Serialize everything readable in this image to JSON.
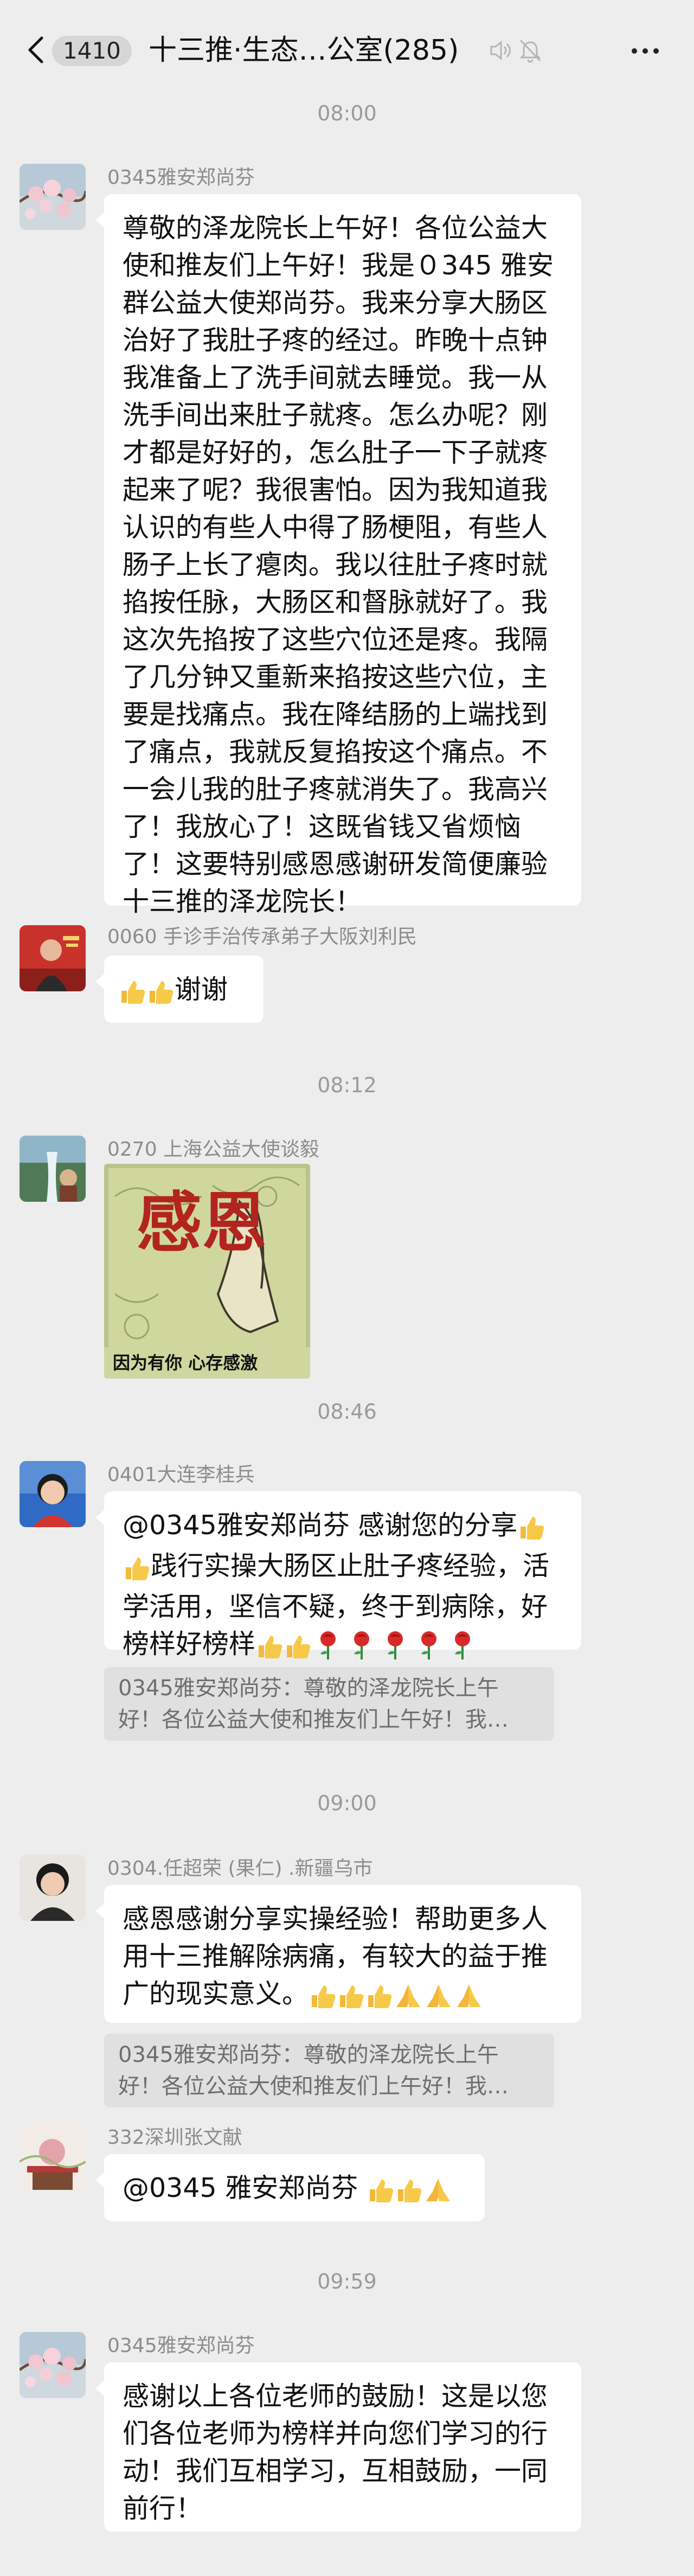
{
  "header": {
    "unread_count": "1410",
    "title": "十三推·生态…公室(285)",
    "mute_icon": "speaker-off-icon",
    "bell_icon": "bell-off-icon",
    "more_icon": "more-dots-icon"
  },
  "timestamps": [
    "08:00",
    "08:12",
    "08:46",
    "09:00",
    "09:59"
  ],
  "messages": [
    {
      "sender": "0345雅安郑尚芬",
      "text": "尊敬的泽龙院长上午好！各位公益大使和推友们上午好！我是０345 雅安群公益大使郑尚芬。我来分享大肠区治好了我肚子疼的经过。昨晚十点钟我准备上了洗手间就去睡觉。我一从洗手间出来肚子就疼。怎么办呢？刚才都是好好的，怎么肚子一下子就疼起来了呢？我很害怕。因为我知道我认识的有些人中得了肠梗阻，有些人肠子上长了瘪肉。我以往肚子疼时就掐按任脉，大肠区和督脉就好了。我这次先掐按了这些穴位还是疼。我隔了几分钟又重新来掐按这些穴位，主要是找痛点。我在降结肠的上端找到了痛点，我就反复掐按这个痛点。不一会儿我的肚子疼就消失了。我高兴了！我放心了！这既省钱又省烦恼了！这要特别感恩感谢研发简便廉验十三推的泽龙院长！"
    },
    {
      "sender": "0060 手诊手治传承弟子大阪刘利民",
      "text": "谢谢"
    },
    {
      "sender": "0270 上海公益大使谈毅",
      "image_title": "感恩",
      "image_caption": "因为有你 心存感激"
    },
    {
      "sender": "0401大连李桂兵",
      "text_part1": "@0345雅安郑尚芬  感谢您的分享",
      "text_part2": "践行实操大肠区止肚子疼经验，活学活用，坚信不疑，终于到病除，好榜样好榜样",
      "quote_line1": "0345雅安郑尚芬：尊敬的泽龙院长上午",
      "quote_line2": "好！各位公益大使和推友们上午好！我…"
    },
    {
      "sender": "0304.任超荣 (果仁) .新疆乌市",
      "text": "感恩感谢分享实操经验！帮助更多人用十三推解除病痛，有较大的益于推广的现实意义。",
      "quote_line1": "0345雅安郑尚芬：尊敬的泽龙院长上午",
      "quote_line2": "好！各位公益大使和推友们上午好！我…"
    },
    {
      "sender": "332深圳张文献",
      "text": "@0345 雅安郑尚芬 "
    },
    {
      "sender": "0345雅安郑尚芬",
      "text": "感谢以上各位老师的鼓励！这是以您们各位老师为榜样并向您们学习的行动！我们互相学习，互相鼓励，一同前行！"
    }
  ]
}
